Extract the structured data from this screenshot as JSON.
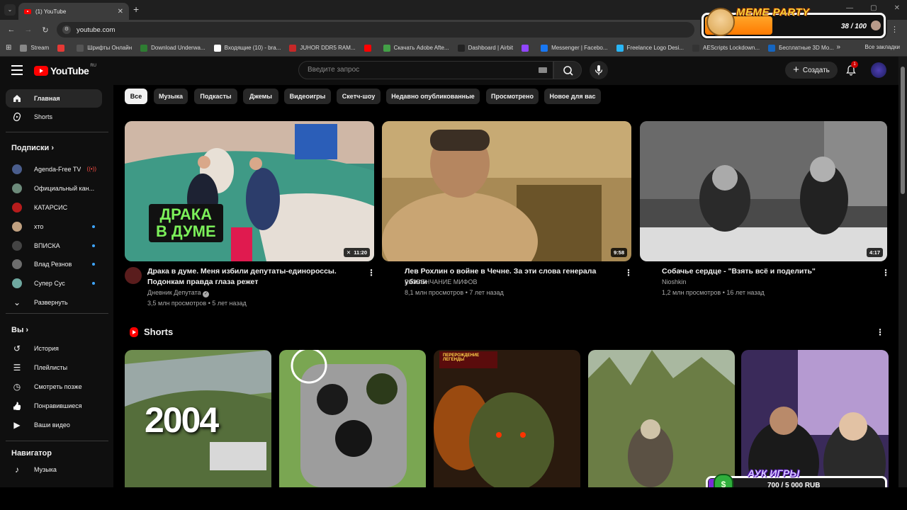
{
  "browser": {
    "tab_title": "(1) YouTube",
    "url": "youtube.com",
    "bookmarks": [
      {
        "label": "Stream",
        "color": "#888888"
      },
      {
        "label": "",
        "color": "#e53935"
      },
      {
        "label": "Шрифты Онлайн",
        "color": "#555555"
      },
      {
        "label": "Download Underwa...",
        "color": "#2e7d32"
      },
      {
        "label": "Входящие (10) - bra...",
        "color": "#ffffff"
      },
      {
        "label": "JUHOR DDR5 RAM...",
        "color": "#c62828"
      },
      {
        "label": "",
        "color": "#ff0000"
      },
      {
        "label": "Скачать Adobe Afte...",
        "color": "#43a047"
      },
      {
        "label": "Dashboard | Airbit",
        "color": "#222222"
      },
      {
        "label": "",
        "color": "#9146ff"
      },
      {
        "label": "Messenger | Facebo...",
        "color": "#1877f2"
      },
      {
        "label": "Freelance Logo Desi...",
        "color": "#29b6f6"
      },
      {
        "label": "AEScripts Lockdown...",
        "color": "#333333"
      },
      {
        "label": "Бесплатные 3D Мо...",
        "color": "#1565c0"
      }
    ],
    "all_bookmarks": "Все закладки",
    "more": "»"
  },
  "meme_overlay": {
    "title": "MEME PARTY",
    "count": "38 / 100",
    "progress": 0.38
  },
  "header": {
    "logo_word": "YouTube",
    "logo_region": "RU",
    "search_placeholder": "Введите запрос",
    "create_label": "Создать",
    "notifications": "1"
  },
  "sidebar": {
    "main": [
      {
        "label": "Главная",
        "icon": "home-icon"
      },
      {
        "label": "Shorts",
        "icon": "shorts-icon"
      }
    ],
    "subs_heading": "Подписки",
    "subscriptions": [
      {
        "label": "Agenda-Free TV",
        "color": "#4a5d8c",
        "status": "live"
      },
      {
        "label": "Официальный кан...",
        "color": "#6c8a7a",
        "status": ""
      },
      {
        "label": "КАТАРСИС",
        "color": "#b71c1c",
        "status": ""
      },
      {
        "label": "хто",
        "color": "#c0a080",
        "status": "new"
      },
      {
        "label": "ВПИСКА",
        "color": "#444444",
        "status": "new"
      },
      {
        "label": "Влад Резнов",
        "color": "#6d6d6d",
        "status": "new"
      },
      {
        "label": "Супер Сус",
        "color": "#6fa8a0",
        "status": "new"
      },
      {
        "label": "Развернуть",
        "color": "",
        "status": ""
      }
    ],
    "you_heading": "Вы",
    "you_items": [
      {
        "label": "История",
        "icon": "history-icon"
      },
      {
        "label": "Плейлисты",
        "icon": "playlists-icon"
      },
      {
        "label": "Смотреть позже",
        "icon": "watch-later-icon"
      },
      {
        "label": "Понравившиеся",
        "icon": "like-icon"
      },
      {
        "label": "Ваши видео",
        "icon": "your-videos-icon"
      }
    ],
    "nav_heading": "Навигатор",
    "nav_items": [
      {
        "label": "Музыка",
        "icon": "music-icon"
      }
    ]
  },
  "chips": [
    "Все",
    "Музыка",
    "Подкасты",
    "Джемы",
    "Видеоигры",
    "Скетч-шоу",
    "Недавно опубликованные",
    "Просмотрено",
    "Новое для вас"
  ],
  "videos": [
    {
      "title_line1": "Драка в думе. Меня избили депутаты-единороссы.",
      "title_line2": "Подонкам правда глаза режет",
      "channel": "Дневник Депутата",
      "verified": true,
      "meta": "3,5 млн просмотров • 5 лет назад",
      "duration": "11:20",
      "overlay_text": [
        "ДРАКА",
        "В ДУМЕ"
      ]
    },
    {
      "title_line1": "Лев Рохлин о войне в Чечне. За эти слова генерала убили",
      "title_line2": "",
      "channel": "РАЗВЕНЧАНИЕ МИФОВ",
      "verified": false,
      "meta": "8,1 млн просмотров • 7 лет назад",
      "duration": "9:58",
      "overlay_text": []
    },
    {
      "title_line1": "Собачье сердце - \"Взять всё и поделить\"",
      "title_line2": "",
      "channel": "Nioshkin",
      "verified": false,
      "meta": "1,2 млн просмотров • 16 лет назад",
      "duration": "4:17",
      "overlay_text": []
    }
  ],
  "shorts": {
    "heading": "Shorts",
    "cards": [
      {
        "overlay": "2004"
      },
      {
        "overlay": ""
      },
      {
        "overlay": "ПЕРЕРОЖДЕНИЕ ЛЕГЕНДЫ"
      },
      {
        "overlay": ""
      },
      {
        "overlay": ""
      }
    ]
  },
  "auction_overlay": {
    "title": "АУК ИГРЫ",
    "amount": "700 / 5 000 RUB",
    "progress": 0.14
  }
}
